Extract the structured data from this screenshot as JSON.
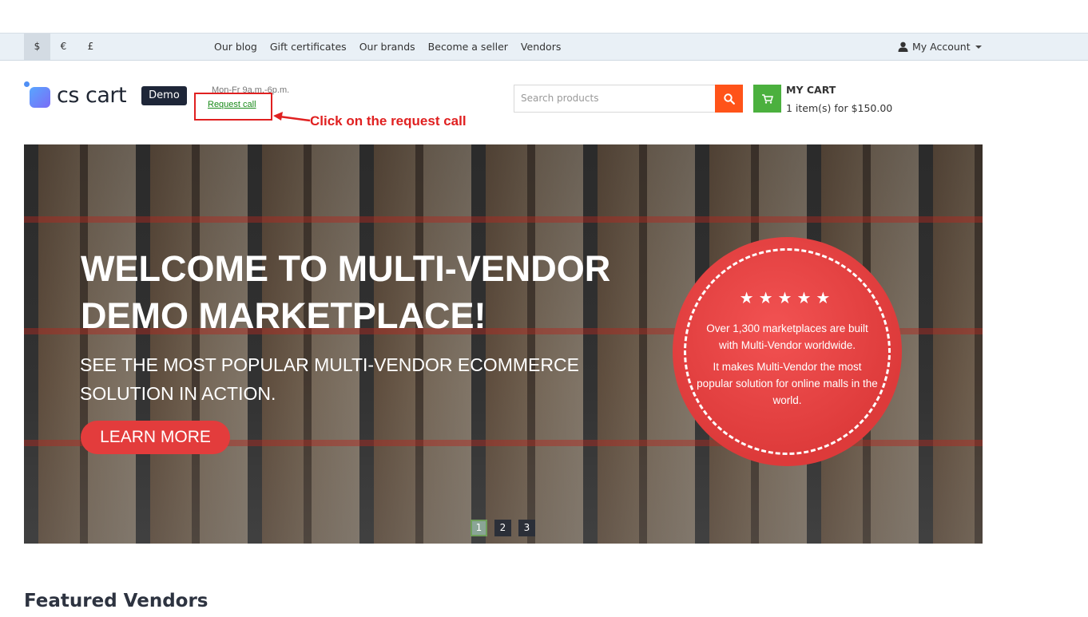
{
  "top_bar": {
    "currencies": [
      "$",
      "€",
      "£"
    ],
    "links": [
      "Our blog",
      "Gift certificates",
      "Our brands",
      "Become a seller",
      "Vendors"
    ],
    "account_label": "My Account"
  },
  "header": {
    "logo_text": "cs cart",
    "demo_badge": "Demo",
    "hours": "Mon-Fr 9a.m.-6p.m.",
    "request_call": "Request call",
    "annotation": "Click on the request call",
    "search_placeholder": "Search products",
    "cart_title": "MY CART",
    "cart_summary": "1 item(s) for $150.00"
  },
  "banner": {
    "headline": "WELCOME TO MULTI-VENDOR DEMO MARKETPLACE!",
    "subheadline": "SEE THE MOST POPULAR MULTI-VENDOR ECOMMERCE SOLUTION IN ACTION.",
    "cta": "LEARN MORE",
    "badge_stars": "★★★★★",
    "badge_line1": "Over 1,300 marketplaces are built with Multi-Vendor worldwide.",
    "badge_line2": "It makes Multi-Vendor the most popular solution for online malls in the world.",
    "pages": [
      "1",
      "2",
      "3"
    ],
    "active_page": "1"
  },
  "sections": {
    "featured_title": "Featured Vendors"
  },
  "colors": {
    "search_button": "#ff5319",
    "cart_button": "#4bb03e",
    "cta_button": "#e33c3c",
    "annotation": "#e02020"
  }
}
